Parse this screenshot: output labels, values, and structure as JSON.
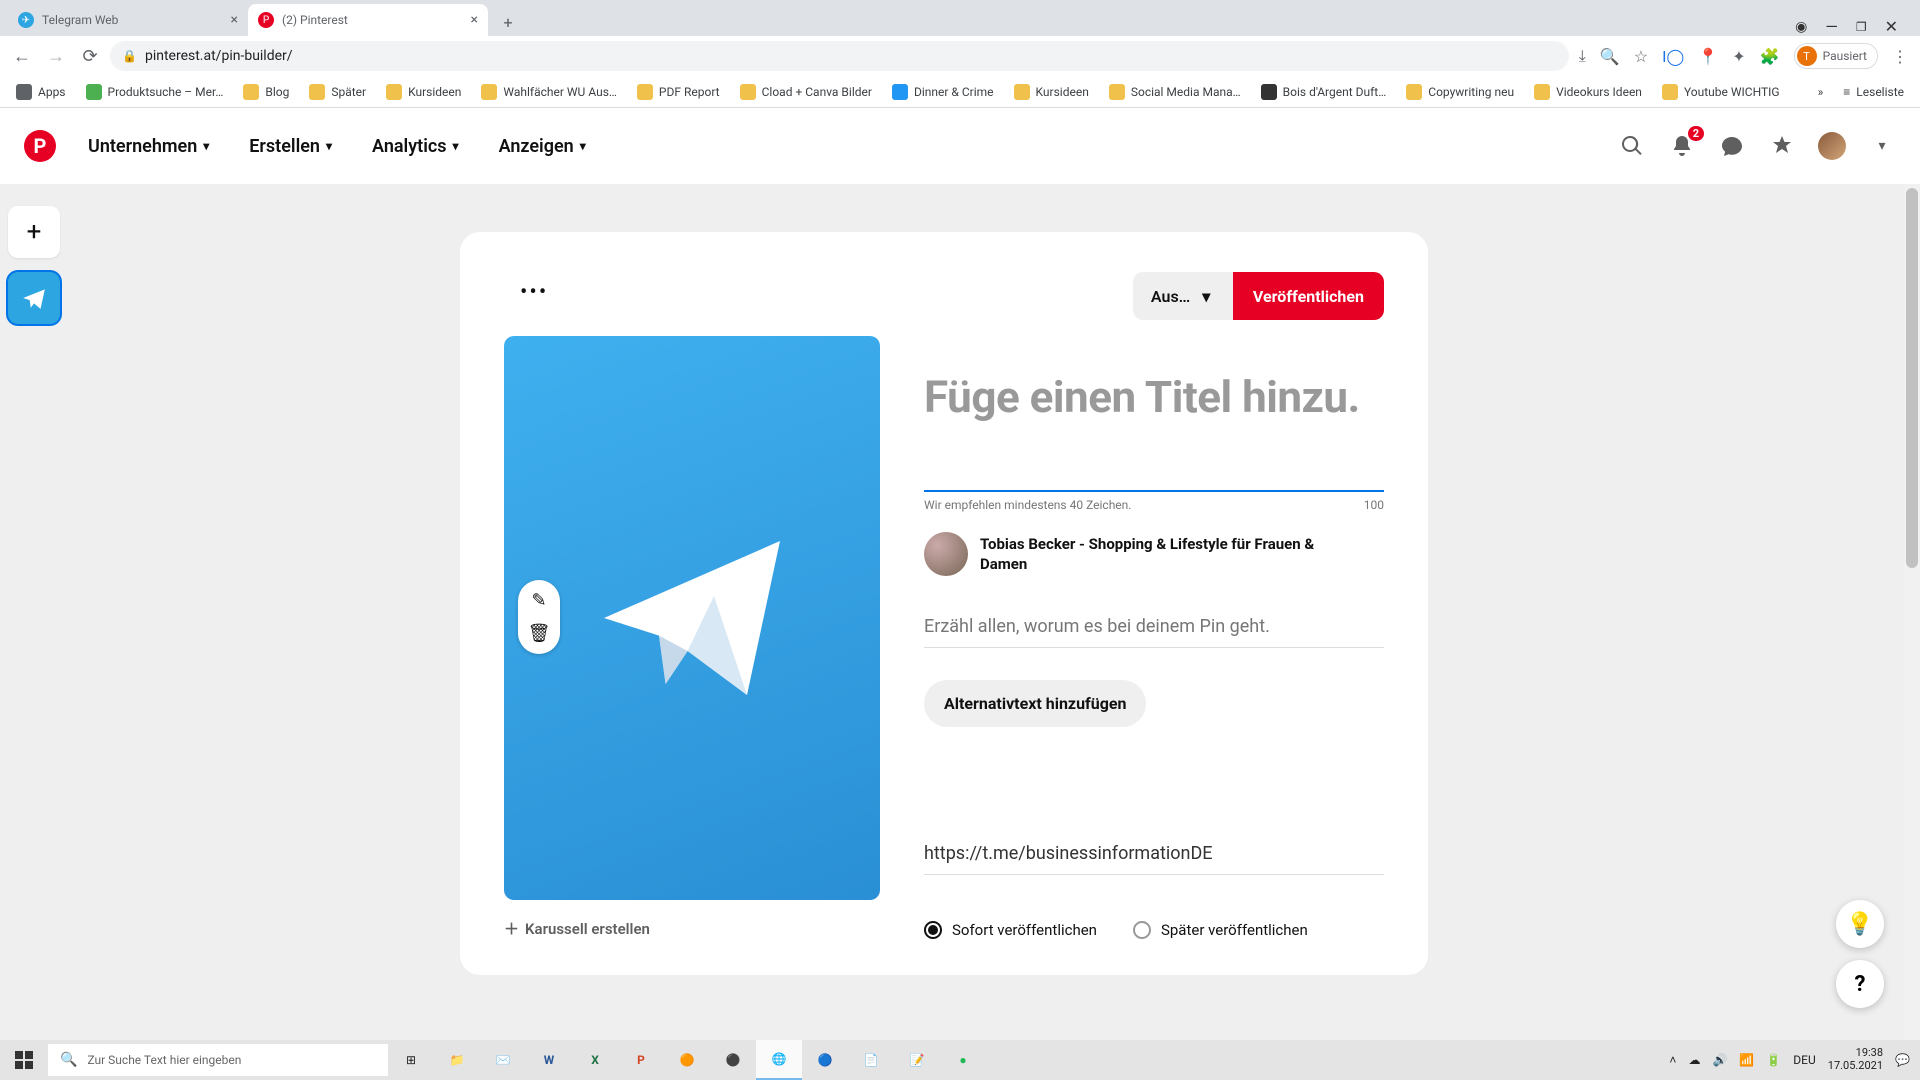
{
  "browser": {
    "tabs": [
      {
        "title": "Telegram Web",
        "favicon": "tg"
      },
      {
        "title": "(2) Pinterest",
        "favicon": "pin"
      }
    ],
    "url": "pinterest.at/pin-builder/",
    "profile_label": "Pausiert",
    "win_incognito_icon": "●"
  },
  "bookmarks": {
    "apps": "Apps",
    "items": [
      "Produktsuche – Mer…",
      "Blog",
      "Später",
      "Kursideen",
      "Wahlfächer WU Aus…",
      "PDF Report",
      "Cload + Canva Bilder",
      "Dinner & Crime",
      "Kursideen",
      "Social Media Mana…",
      "Bois d'Argent Duft…",
      "Copywriting neu",
      "Videokurs Ideen",
      "Youtube WICHTIG"
    ],
    "readlist": "Leseliste"
  },
  "pin_header": {
    "nav": [
      "Unternehmen",
      "Erstellen",
      "Analytics",
      "Anzeigen"
    ],
    "notification_count": "2"
  },
  "builder": {
    "more": "•••",
    "board_select": "Aus…",
    "publish": "Veröffentlichen",
    "karussell": "Karussell erstellen",
    "title_placeholder": "Füge einen Titel hinzu.",
    "title_hint": "Wir empfehlen mindestens 40 Zeichen.",
    "title_counter": "100",
    "author": "Tobias Becker - Shopping & Lifestyle für Frauen & Damen",
    "desc_placeholder": "Erzähl allen, worum es bei deinem Pin geht.",
    "alt_button": "Alternativtext hinzufügen",
    "link_value": "https://t.me/businessinformationDE",
    "radio_now": "Sofort veröffentlichen",
    "radio_later": "Später veröffentlichen"
  },
  "taskbar": {
    "search_placeholder": "Zur Suche Text hier eingeben",
    "lang": "DEU",
    "time": "19:38",
    "date": "17.05.2021"
  }
}
